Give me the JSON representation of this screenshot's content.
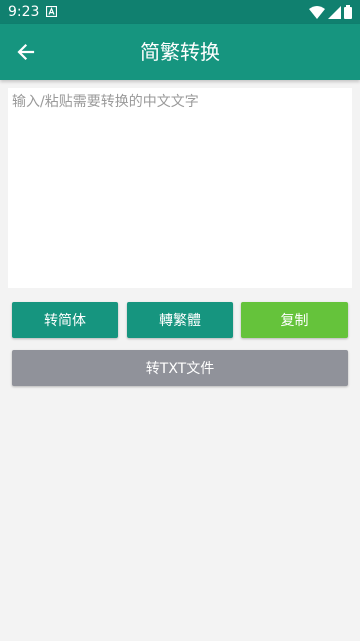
{
  "status_bar": {
    "time": "9:23",
    "colors": {
      "background": "#10806f"
    }
  },
  "app_bar": {
    "title": "简繁转换",
    "back_icon": "arrow-left-icon",
    "colors": {
      "background": "#16957f"
    }
  },
  "input": {
    "value": "",
    "placeholder": "输入/粘贴需要转换的中文文字"
  },
  "buttons": {
    "to_simplified": "转简体",
    "to_traditional": "轉繁體",
    "copy": "复制",
    "to_txt": "转TXT文件"
  },
  "colors": {
    "primary": "#16957f",
    "copy": "#65c33b",
    "txt": "#90929a",
    "page_background": "#f3f3f3"
  }
}
